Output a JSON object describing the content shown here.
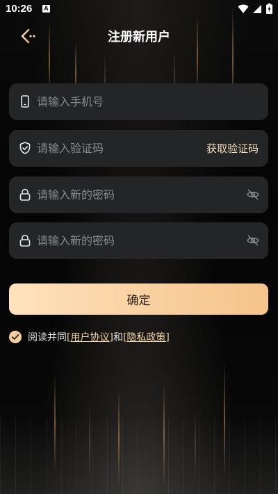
{
  "status_bar": {
    "time": "10:26",
    "notification_badge": "A",
    "icons": [
      "wifi-icon",
      "signal-icon",
      "battery-charging-icon"
    ]
  },
  "header": {
    "title": "注册新用户",
    "back_icon": "back-arrow-icon"
  },
  "form": {
    "phone": {
      "placeholder": "请输入手机号",
      "value": "",
      "icon": "phone-icon"
    },
    "code": {
      "placeholder": "请输入验证码",
      "value": "",
      "icon": "shield-check-icon",
      "action_label": "获取验证码"
    },
    "password": {
      "placeholder": "请输入新的密码",
      "value": "",
      "icon": "lock-icon",
      "toggle_icon": "eye-off-icon"
    },
    "confirm_password": {
      "placeholder": "请输入新的密码",
      "value": "",
      "icon": "lock-icon",
      "toggle_icon": "eye-off-icon"
    },
    "submit_label": "确定"
  },
  "agreement": {
    "checked": true,
    "prefix": "阅读并同",
    "user_agreement": "[用户协议]",
    "conjunction": "和",
    "privacy_policy": "[隐私政策]"
  },
  "colors": {
    "accent": "#f6c892",
    "field_bg": "#242526",
    "background": "#050505"
  }
}
